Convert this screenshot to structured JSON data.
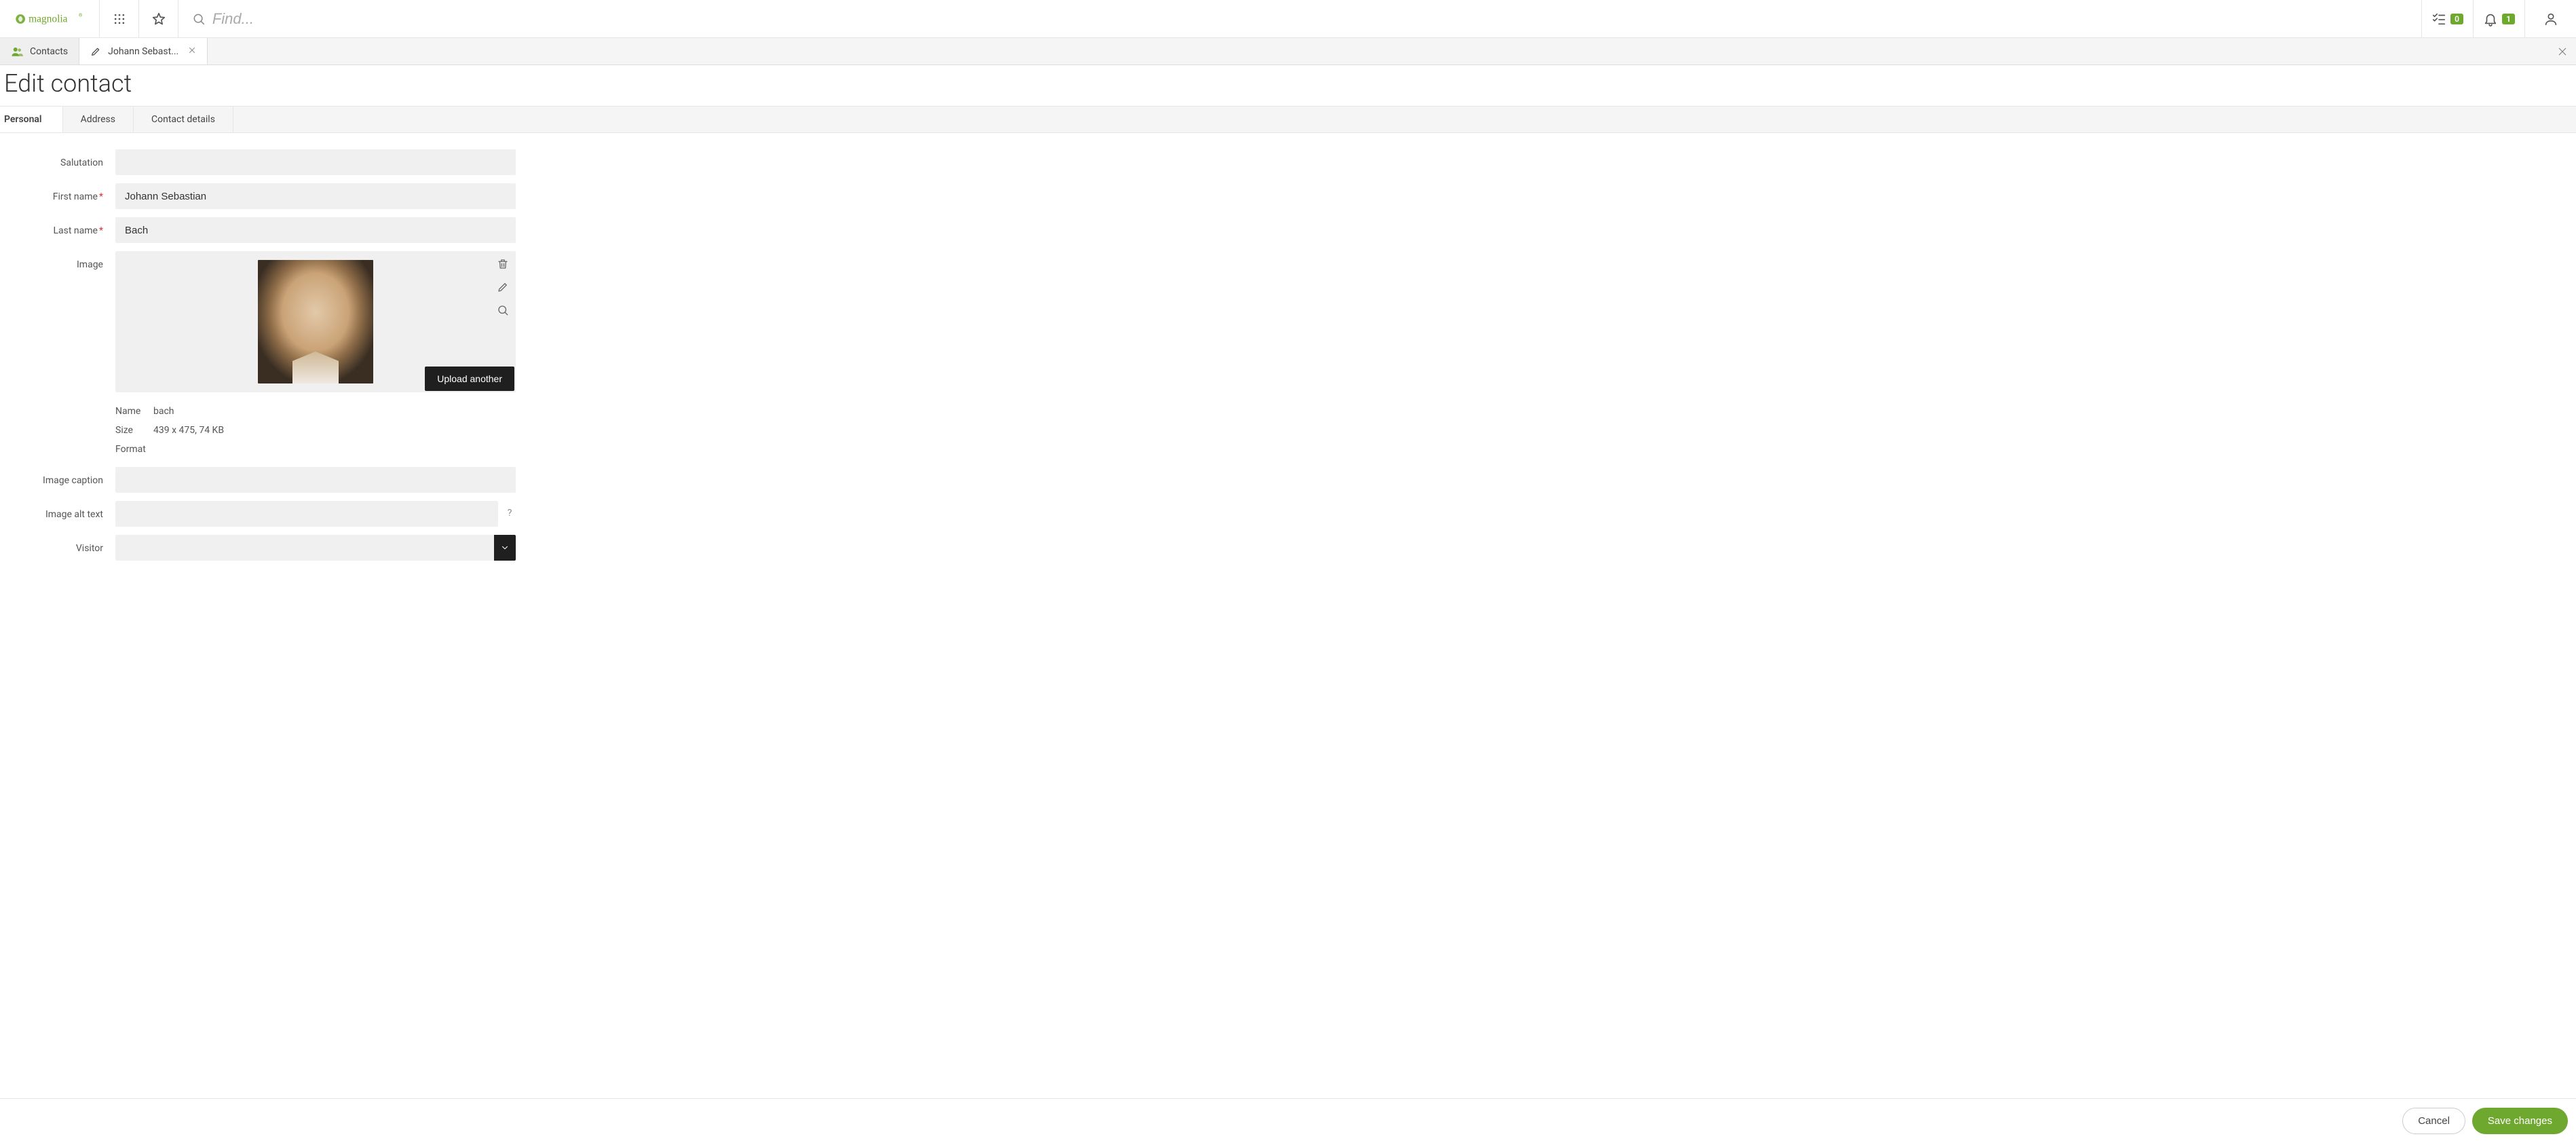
{
  "brand": {
    "name": "magnolia"
  },
  "topbar": {
    "search_placeholder": "Find...",
    "tasks_count": "0",
    "notifications_count": "1"
  },
  "subapp_tabs": {
    "items": [
      {
        "label": "Contacts"
      },
      {
        "label": "Johann Sebast..."
      }
    ]
  },
  "page": {
    "title": "Edit contact"
  },
  "form_tabs": {
    "items": [
      {
        "label": "Personal"
      },
      {
        "label": "Address"
      },
      {
        "label": "Contact details"
      }
    ]
  },
  "form": {
    "salutation": {
      "label": "Salutation",
      "value": ""
    },
    "first_name": {
      "label": "First name",
      "value": "Johann Sebastian",
      "required": true
    },
    "last_name": {
      "label": "Last name",
      "value": "Bach",
      "required": true
    },
    "image": {
      "label": "Image",
      "upload_another": "Upload another",
      "meta": {
        "name_label": "Name",
        "name": "bach",
        "size_label": "Size",
        "size": "439 x 475, 74 KB",
        "format_label": "Format",
        "format": ""
      }
    },
    "image_caption": {
      "label": "Image caption",
      "value": ""
    },
    "image_alt": {
      "label": "Image alt text",
      "value": "",
      "help": "?"
    },
    "visitor": {
      "label": "Visitor",
      "value": ""
    }
  },
  "footer": {
    "cancel": "Cancel",
    "save": "Save changes"
  },
  "colors": {
    "accent": "#6fa82e"
  }
}
